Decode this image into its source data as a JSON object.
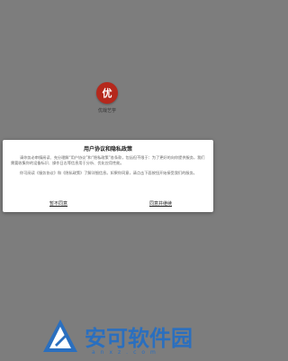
{
  "splash": {
    "logo_text": "优",
    "app_name": "优哉艺学"
  },
  "dialog": {
    "title": "用户协议和隐私政策",
    "para1": "请你务必审慎阅读、充分理解“用户协议”和“隐私政策”各条款，包括但不限于：为了更好的向你提供服务，我们需要收集你的设备标识、操作日志等信息用于分析、优化应用性能。",
    "para2": "你可阅读《服务协议》和《隐私政策》了解详细信息。如果你同意，请点击下面按钮开始接受我们的服务。",
    "disagree_label": "暂不同意",
    "agree_label": "同意并继续"
  },
  "watermark": {
    "text": "安可软件园",
    "sub": "anxz.com"
  },
  "colors": {
    "overlay": "#7d7d7d",
    "logo_red": "#b5281c",
    "watermark_blue": "#2a6fbf"
  }
}
